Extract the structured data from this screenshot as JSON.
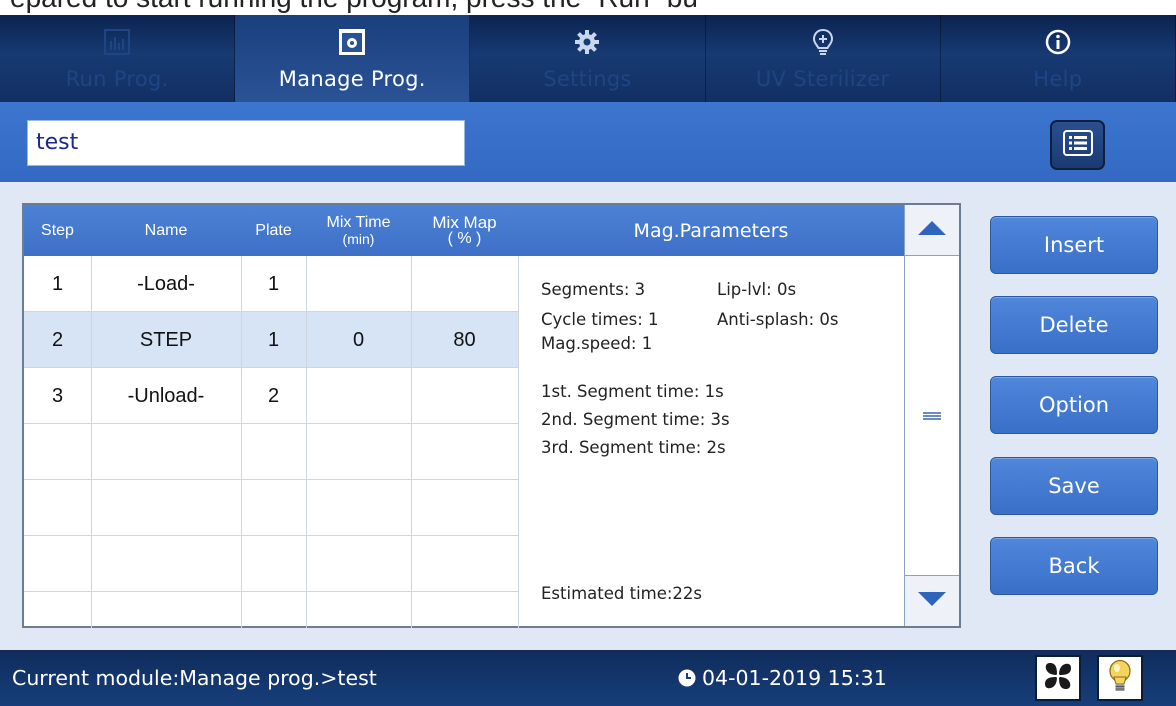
{
  "caption": "epared to start running the program, press the “Run” bu",
  "tabs": [
    {
      "label": "Run Prog.",
      "icon": "run-program-icon",
      "active": false
    },
    {
      "label": "Manage Prog.",
      "icon": "manage-program-icon",
      "active": true
    },
    {
      "label": "Settings",
      "icon": "gear-icon",
      "active": false
    },
    {
      "label": "UV Sterilizer",
      "icon": "bulb-icon",
      "active": false
    },
    {
      "label": "Help",
      "icon": "info-icon",
      "active": false
    }
  ],
  "program_name": {
    "value": "test"
  },
  "table": {
    "headers": {
      "step": "Step",
      "name": "Name",
      "plate": "Plate",
      "mix_time": "Mix Time",
      "mix_time_unit": "(min)",
      "mix_map": "Mix Map",
      "mix_map_unit": "( % )",
      "params": "Mag.Parameters"
    },
    "rows": [
      {
        "step": "1",
        "name": "-Load-",
        "plate": "1",
        "mix_time": "",
        "mix_map": ""
      },
      {
        "step": "2",
        "name": "STEP",
        "plate": "1",
        "mix_time": "0",
        "mix_map": "80",
        "selected": true
      },
      {
        "step": "3",
        "name": "-Unload-",
        "plate": "2",
        "mix_time": "",
        "mix_map": ""
      },
      {
        "step": "",
        "name": "",
        "plate": "",
        "mix_time": "",
        "mix_map": ""
      },
      {
        "step": "",
        "name": "",
        "plate": "",
        "mix_time": "",
        "mix_map": ""
      },
      {
        "step": "",
        "name": "",
        "plate": "",
        "mix_time": "",
        "mix_map": ""
      },
      {
        "step": "",
        "name": "",
        "plate": "",
        "mix_time": "",
        "mix_map": ""
      }
    ]
  },
  "params": {
    "segments": "Segments: 3",
    "lip_lvl": "Lip-lvl: 0s",
    "cycle_times": "Cycle times: 1",
    "anti_splash": "Anti-splash: 0s",
    "mag_speed": "Mag.speed: 1",
    "seg1": "1st. Segment time: 1s",
    "seg2": "2nd. Segment time: 3s",
    "seg3": "3rd. Segment time: 2s",
    "estimated": "Estimated time:22s"
  },
  "buttons": {
    "insert": "Insert",
    "delete": "Delete",
    "option": "Option",
    "save": "Save",
    "back": "Back"
  },
  "status": {
    "module": "Current module:Manage prog.>test",
    "datetime": "04-01-2019 15:31"
  },
  "colors": {
    "header_blue": "#3d70c6",
    "selected_row": "#d6e4f5",
    "button_blue": "#4f87db",
    "nav_dark": "#122f63"
  }
}
